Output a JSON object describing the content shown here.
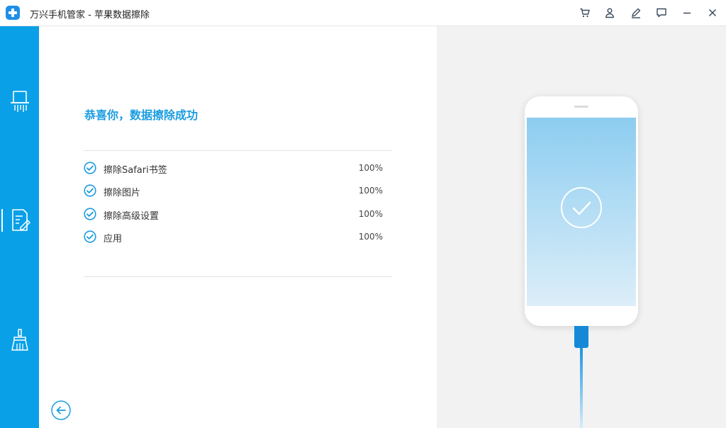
{
  "window": {
    "title": "万兴手机管家 - 苹果数据擦除",
    "controls": [
      {
        "name": "cart-icon-button"
      },
      {
        "name": "user-icon-button"
      },
      {
        "name": "edit-icon-button"
      },
      {
        "name": "feedback-icon-button"
      },
      {
        "name": "minimize-button"
      },
      {
        "name": "close-button"
      }
    ]
  },
  "sidebar": {
    "items": [
      {
        "icon": "shredder-icon"
      },
      {
        "icon": "erase-document-icon",
        "active": true
      },
      {
        "icon": "broom-icon"
      }
    ]
  },
  "main": {
    "headline": "恭喜你，数据擦除成功",
    "tasks": [
      {
        "label": "擦除Safari书签",
        "percent": "100%"
      },
      {
        "label": "擦除图片",
        "percent": "100%"
      },
      {
        "label": "擦除高级设置",
        "percent": "100%"
      },
      {
        "label": "应用",
        "percent": "100%"
      }
    ],
    "back_icon": "arrow-left-circle-icon"
  },
  "device": {
    "status_icon": "checkmark-circle-icon"
  },
  "colors": {
    "accent": "#0aa0e8",
    "headline": "#1a9ce0",
    "panel_bg": "#f2f2f2"
  }
}
